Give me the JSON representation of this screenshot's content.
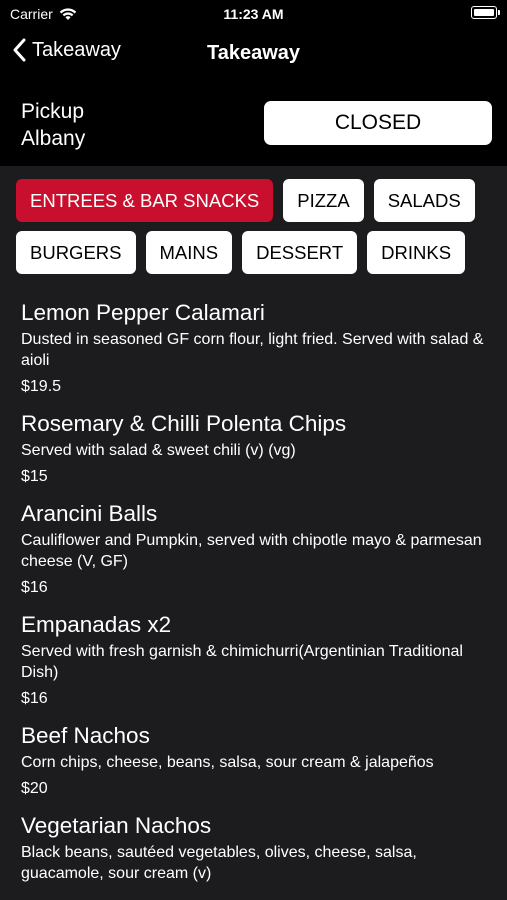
{
  "status_bar": {
    "carrier": "Carrier",
    "time": "11:23 AM"
  },
  "nav": {
    "back_label": "Takeaway",
    "title": "Takeaway"
  },
  "pickup": {
    "line1": "Pickup",
    "line2": "Albany",
    "status": "CLOSED"
  },
  "categories": {
    "row1": [
      "ENTREES & BAR SNACKS",
      "PIZZA",
      "SALADS"
    ],
    "row2": [
      "BURGERS",
      "MAINS",
      "DESSERT",
      "DRINKS"
    ],
    "active": "ENTREES & BAR SNACKS",
    "active_color": "#c8102e"
  },
  "menu_items": [
    {
      "name": "Lemon Pepper Calamari",
      "description": "Dusted in seasoned GF corn flour, light fried. Served with salad & aioli",
      "price": "$19.5"
    },
    {
      "name": "Rosemary & Chilli Polenta Chips",
      "description": "Served with salad & sweet chili (v) (vg)",
      "price": "$15"
    },
    {
      "name": "Arancini Balls",
      "description": "Cauliflower and Pumpkin, served with chipotle mayo & parmesan cheese (V, GF)",
      "price": "$16"
    },
    {
      "name": "Empanadas x2",
      "description": "Served with fresh garnish & chimichurri(Argentinian Traditional Dish)",
      "price": "$16"
    },
    {
      "name": "Beef Nachos",
      "description": "Corn chips, cheese, beans, salsa, sour cream & jalapeños",
      "price": "$20"
    },
    {
      "name": "Vegetarian Nachos",
      "description": "Black beans, sautéed vegetables, olives, cheese, salsa, guacamole, sour cream (v)",
      "price": ""
    }
  ]
}
